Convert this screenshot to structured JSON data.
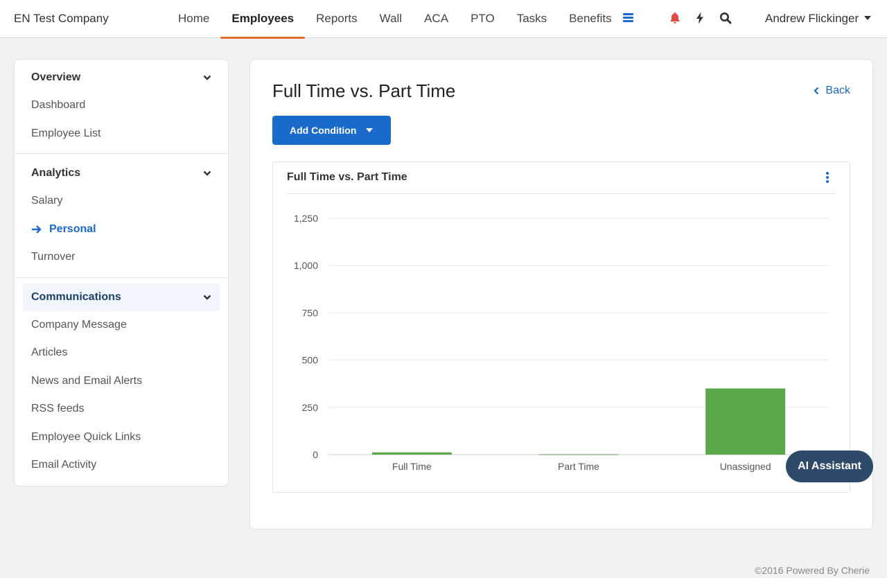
{
  "header": {
    "company": "EN Test Company",
    "nav": [
      {
        "label": "Home",
        "active": false
      },
      {
        "label": "Employees",
        "active": true
      },
      {
        "label": "Reports",
        "active": false
      },
      {
        "label": "Wall",
        "active": false
      },
      {
        "label": "ACA",
        "active": false
      },
      {
        "label": "PTO",
        "active": false
      },
      {
        "label": "Tasks",
        "active": false
      },
      {
        "label": "Benefits",
        "active": false
      }
    ],
    "user": "Andrew Flickinger",
    "icons": [
      "menu-icon",
      "bell-icon",
      "bolt-icon",
      "search-icon"
    ],
    "colors": {
      "accent": "#1a6acb",
      "active_underline": "#e2702c",
      "alert": "#e04a3f"
    }
  },
  "sidebar": {
    "sections": [
      {
        "title": "Overview",
        "items": [
          "Dashboard",
          "Employee List"
        ]
      },
      {
        "title": "Analytics",
        "items": [
          "Salary",
          "Personal",
          "Turnover"
        ]
      },
      {
        "title": "Communications",
        "items": [
          "Company Message",
          "Articles",
          "News and Email Alerts",
          "RSS feeds",
          "Employee Quick Links",
          "Email Activity"
        ]
      }
    ],
    "current_item": "Personal",
    "highlighted_section": "Communications"
  },
  "main": {
    "title": "Full Time vs. Part Time",
    "back_label": "Back",
    "add_condition_label": "Add Condition",
    "card_title": "Full Time vs. Part Time"
  },
  "chart_data": {
    "type": "bar",
    "title": "Full Time vs. Part Time",
    "categories": [
      "Full Time",
      "Part Time",
      "Unassigned"
    ],
    "values": [
      12,
      2,
      350
    ],
    "ylim": [
      0,
      1250
    ],
    "yticks": [
      0,
      250,
      500,
      750,
      1000,
      1250
    ],
    "ytick_labels": [
      "0",
      "250",
      "500",
      "750",
      "1,000",
      "1,250"
    ],
    "xlabel": "",
    "ylabel": "",
    "grid": true,
    "color": "#5aa84a"
  },
  "ai_assistant_label": "AI Assistant",
  "footer": "©2016 Powered By Cherie"
}
